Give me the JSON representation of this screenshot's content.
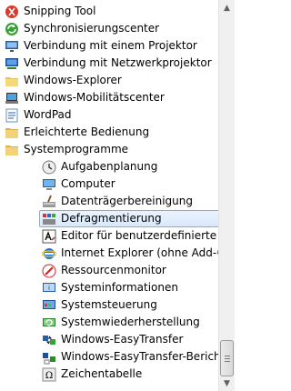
{
  "menu": {
    "items": [
      {
        "label": "Snipping Tool",
        "icon": "scissors-icon",
        "level": 0
      },
      {
        "label": "Synchronisierungscenter",
        "icon": "sync-icon",
        "level": 0
      },
      {
        "label": "Verbindung mit einem Projektor",
        "icon": "projector-icon",
        "level": 0
      },
      {
        "label": "Verbindung mit Netzwerkprojektor",
        "icon": "network-projector-icon",
        "level": 0
      },
      {
        "label": "Windows-Explorer",
        "icon": "folder-explorer-icon",
        "level": 0
      },
      {
        "label": "Windows-Mobilitätscenter",
        "icon": "mobility-center-icon",
        "level": 0
      },
      {
        "label": "WordPad",
        "icon": "wordpad-icon",
        "level": 0
      },
      {
        "label": "Erleichterte Bedienung",
        "icon": "folder-icon",
        "level": 0
      },
      {
        "label": "Systemprogramme",
        "icon": "folder-icon",
        "level": 0
      },
      {
        "label": "Aufgabenplanung",
        "icon": "clock-icon",
        "level": 1
      },
      {
        "label": "Computer",
        "icon": "computer-icon",
        "level": 1
      },
      {
        "label": "Datenträgerbereinigung",
        "icon": "disk-cleanup-icon",
        "level": 1
      },
      {
        "label": "Defragmentierung",
        "icon": "defrag-icon",
        "level": 1,
        "selected": true
      },
      {
        "label": "Editor für benutzerdefinierte Zeic",
        "icon": "char-editor-icon",
        "level": 1
      },
      {
        "label": "Internet Explorer (ohne Add-Ons",
        "icon": "ie-icon",
        "level": 1
      },
      {
        "label": "Ressourcenmonitor",
        "icon": "resource-monitor-icon",
        "level": 1
      },
      {
        "label": "Systeminformationen",
        "icon": "system-info-icon",
        "level": 1
      },
      {
        "label": "Systemsteuerung",
        "icon": "control-panel-icon",
        "level": 1
      },
      {
        "label": "Systemwiederherstellung",
        "icon": "system-restore-icon",
        "level": 1
      },
      {
        "label": "Windows-EasyTransfer",
        "icon": "easy-transfer-icon",
        "level": 1
      },
      {
        "label": "Windows-EasyTransfer-Berichte",
        "icon": "easy-transfer-report-icon",
        "level": 1
      },
      {
        "label": "Zeichentabelle",
        "icon": "char-map-icon",
        "level": 1
      }
    ]
  },
  "scrollbar": {
    "up_arrow": "▲",
    "down_arrow": "▼"
  }
}
